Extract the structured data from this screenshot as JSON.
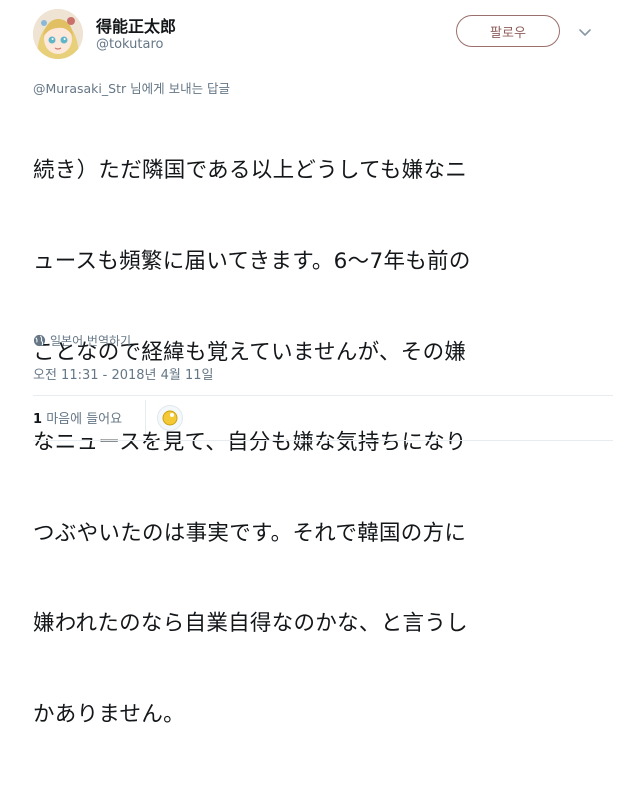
{
  "author": {
    "display_name": "得能正太郎",
    "handle": "@tokutaro",
    "avatar_icon": "user-avatar-illustration"
  },
  "follow_button": {
    "label": "팔로우",
    "color": "#8f5f5b"
  },
  "menu_icon": "chevron-down-icon",
  "reply_to": {
    "mention": "@Murasaki_Str",
    "suffix": " 님에게 보내는 답글"
  },
  "tweet": {
    "text_lines": [
      "続き）ただ隣国である以上どうしても嫌なニ",
      "ュースも頻繁に届いてきます。6〜7年も前の",
      "ことなので経緯も覚えていませんが、その嫌",
      "なニュースを見て、自分も嫌な気持ちになり",
      "つぶやいたのは事実です。それで韓国の方に",
      "嫌われたのなら自業自得なのかな、と言うし",
      "かありません。"
    ]
  },
  "translate": {
    "label": "일본어 번역하기",
    "icon": "globe-icon"
  },
  "timestamp": "오전 11:31 - 2018년 4월 11일",
  "likes": {
    "count": "1",
    "label": "마음에 들어요"
  },
  "liker_avatar_icon": "liker-avatar-icon"
}
